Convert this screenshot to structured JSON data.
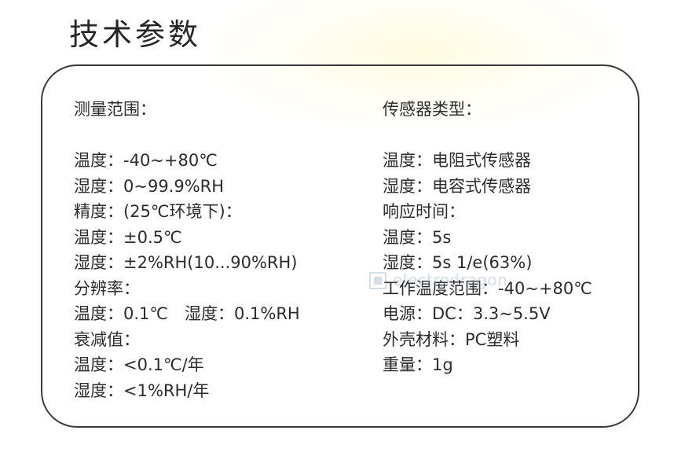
{
  "title": "技术参数",
  "watermark": {
    "logo_text": "electrodragon"
  },
  "left_column": [
    {
      "text": "测量范围：",
      "kind": "head"
    },
    {
      "text": "",
      "kind": "gap"
    },
    {
      "text": "温度：-40~+80℃",
      "kind": "row"
    },
    {
      "text": "湿度：0~99.9%RH",
      "kind": "row"
    },
    {
      "text": "精度：(25℃环境下)：",
      "kind": "row"
    },
    {
      "text": "温度：±0.5℃",
      "kind": "row"
    },
    {
      "text": "湿度：±2%RH(10...90%RH)",
      "kind": "row"
    },
    {
      "text": "分辨率：",
      "kind": "row"
    },
    {
      "text": "温度：0.1℃　湿度：0.1%RH",
      "kind": "row"
    },
    {
      "text": "衰减值：",
      "kind": "row"
    },
    {
      "text": "温度：<0.1℃/年",
      "kind": "row"
    },
    {
      "text": "湿度：<1%RH/年",
      "kind": "row"
    }
  ],
  "right_column": [
    {
      "text": "传感器类型：",
      "kind": "head"
    },
    {
      "text": "",
      "kind": "gap"
    },
    {
      "text": "温度：电阻式传感器",
      "kind": "row"
    },
    {
      "text": "湿度：电容式传感器",
      "kind": "row"
    },
    {
      "text": "响应时间：",
      "kind": "row"
    },
    {
      "text": "温度：5s",
      "kind": "row"
    },
    {
      "text": "湿度：5s 1/e(63%)",
      "kind": "row"
    },
    {
      "text": "工作温度范围：-40~+80℃",
      "kind": "row"
    },
    {
      "text": "电源：DC：3.3~5.5V",
      "kind": "row"
    },
    {
      "text": "外壳材料：PC塑料",
      "kind": "row"
    },
    {
      "text": "重量：1g",
      "kind": "row"
    }
  ],
  "colors": {
    "text": "#2c2c2c",
    "border": "#3a3a3a",
    "watermark": "#8aa0b8",
    "glow": "#fff8c8"
  }
}
